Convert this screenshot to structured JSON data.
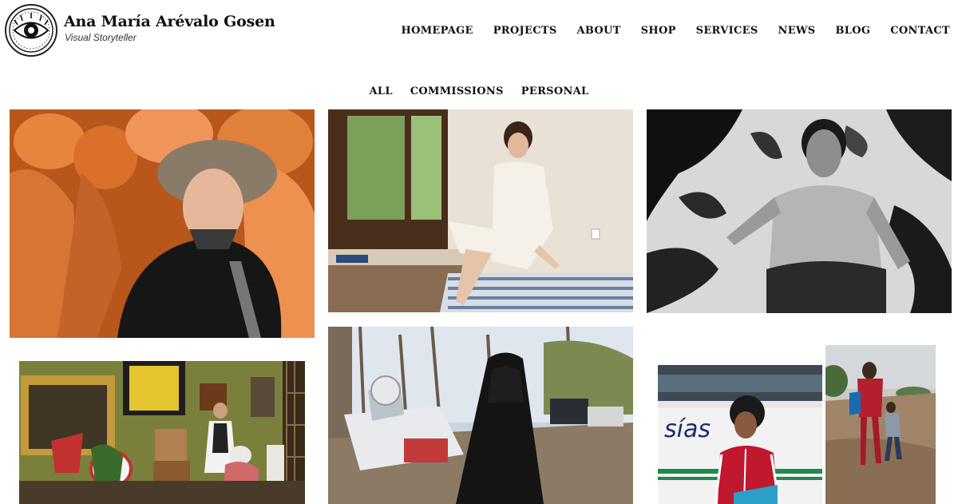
{
  "header": {
    "title": "Ana María Arévalo Gosen",
    "subtitle": "Visual Storyteller",
    "logo_icon": "eye-icon"
  },
  "nav": [
    {
      "label": "HOMEPAGE"
    },
    {
      "label": "PROJECTS"
    },
    {
      "label": "ABOUT"
    },
    {
      "label": "SHOP"
    },
    {
      "label": "SERVICES"
    },
    {
      "label": "NEWS"
    },
    {
      "label": "BLOG"
    },
    {
      "label": "CONTACT"
    }
  ],
  "filters": [
    {
      "label": "ALL"
    },
    {
      "label": "COMMISSIONS"
    },
    {
      "label": "PERSONAL"
    }
  ],
  "gallery": {
    "bus_text": "sías"
  },
  "colors": {
    "text": "#111111",
    "background": "#ffffff",
    "sculpture_orange": "#e8843c",
    "jacket_red": "#c0182e"
  }
}
